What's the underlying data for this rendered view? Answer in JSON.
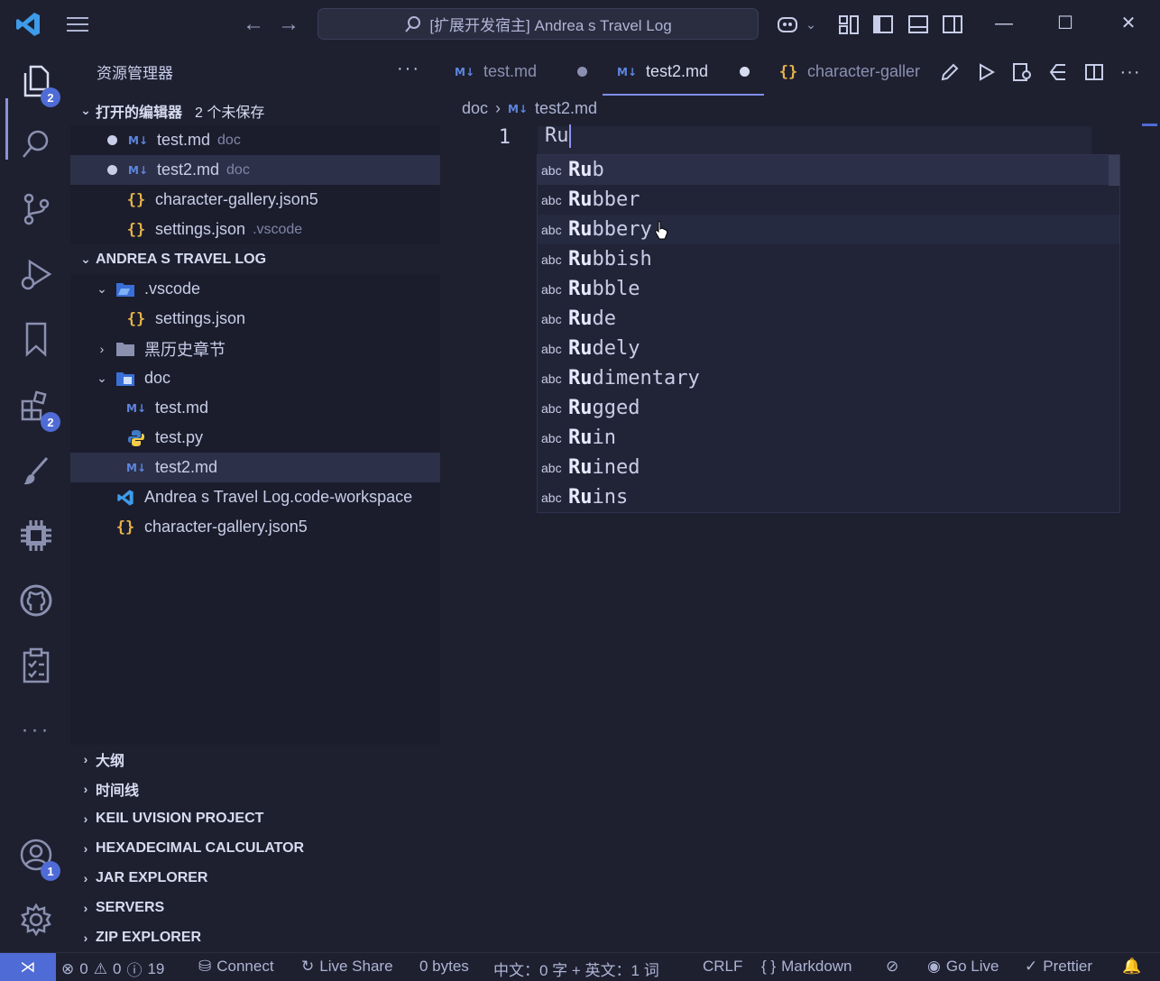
{
  "titlebar": {
    "search_text": "[扩展开发宿主] Andrea s Travel Log"
  },
  "activity": {
    "explorer_badge": "2",
    "extensions_badge": "2",
    "accounts_badge": "1"
  },
  "sidebar": {
    "title": "资源管理器",
    "open_editors": {
      "label": "打开的编辑器",
      "unsaved": "2 个未保存",
      "items": [
        {
          "name": "test.md",
          "desc": "doc"
        },
        {
          "name": "test2.md",
          "desc": "doc"
        },
        {
          "name": "character-gallery.json5",
          "desc": ""
        },
        {
          "name": "settings.json",
          "desc": ".vscode"
        }
      ]
    },
    "workspace": {
      "label": "ANDREA S TRAVEL LOG",
      "vscode_folder": ".vscode",
      "settings_file": "settings.json",
      "history_folder": "黑历史章节",
      "doc_folder": "doc",
      "test_md": "test.md",
      "test_py": "test.py",
      "test2_md": "test2.md",
      "workspace_file": "Andrea s Travel Log.code-workspace",
      "gallery_file": "character-gallery.json5"
    },
    "panels": [
      "大纲",
      "时间线",
      "KEIL UVISION PROJECT",
      "HEXADECIMAL CALCULATOR",
      "JAR EXPLORER",
      "SERVERS",
      "ZIP EXPLORER"
    ]
  },
  "tabs": [
    {
      "label": "test.md"
    },
    {
      "label": "test2.md"
    },
    {
      "label": "character-galler"
    }
  ],
  "editor": {
    "breadcrumb": [
      "doc",
      "test2.md"
    ],
    "line_number": "1",
    "line_text": "Ru",
    "suggestions": [
      {
        "match": "Ru",
        "rest": "b"
      },
      {
        "match": "Ru",
        "rest": "bber"
      },
      {
        "match": "Ru",
        "rest": "bbery"
      },
      {
        "match": "Ru",
        "rest": "bbish"
      },
      {
        "match": "Ru",
        "rest": "bble"
      },
      {
        "match": "Ru",
        "rest": "de"
      },
      {
        "match": "Ru",
        "rest": "dely"
      },
      {
        "match": "Ru",
        "rest": "dimentary"
      },
      {
        "match": "Ru",
        "rest": "gged"
      },
      {
        "match": "Ru",
        "rest": "in"
      },
      {
        "match": "Ru",
        "rest": "ined"
      },
      {
        "match": "Ru",
        "rest": "ins"
      }
    ],
    "suggestion_kind": "abc"
  },
  "statusbar": {
    "errors": "0",
    "warnings": "0",
    "infos": "19",
    "connect": "Connect",
    "live_share": "Live Share",
    "bytes": "0 bytes",
    "word_count": "中文：0 字 + 英文：1 词",
    "eol": "CRLF",
    "language": "Markdown",
    "go_live": "Go Live",
    "prettier": "Prettier"
  },
  "colors": {
    "accent": "#4f6bd5",
    "json_icon": "#e5b24a",
    "md_icon": "#5e86e0"
  }
}
